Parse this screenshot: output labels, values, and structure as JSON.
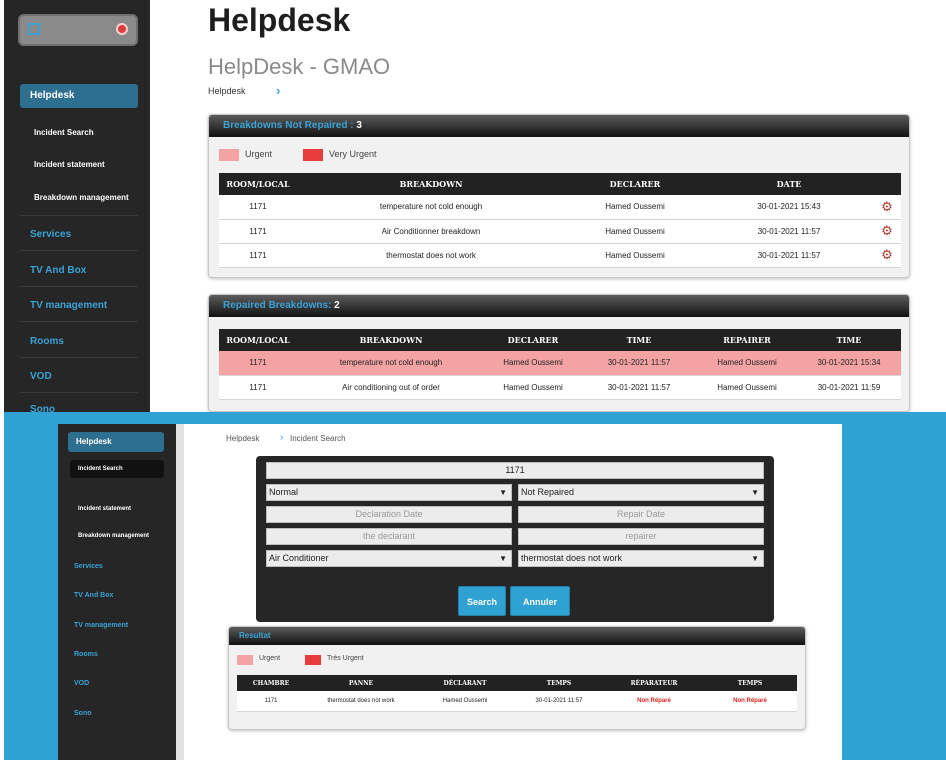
{
  "top": {
    "sidebar": {
      "active": "Helpdesk",
      "subitems": [
        "Incident Search",
        "Incident statement",
        "Breakdown management"
      ],
      "items": [
        "Services",
        "TV And Box",
        "TV management",
        "Rooms",
        "VOD",
        "Sono"
      ]
    },
    "title": "Helpdesk",
    "subtitle": "HelpDesk - GMAO",
    "breadcrumb": "Helpdesk",
    "breakdowns_panel": {
      "title": "Breakdowns Not Repaired :",
      "count": "3",
      "legend": [
        {
          "label": "Urgent",
          "color": "#f3a3a3"
        },
        {
          "label": "Very Urgent",
          "color": "#e83b3b"
        }
      ],
      "headers": [
        "ROOM/LOCAL",
        "BREAKDOWN",
        "DECLARER",
        "DATE"
      ],
      "rows": [
        {
          "room": "1171",
          "breakdown": "temperature not cold enough",
          "declarer": "Hamed Oussemi",
          "date": "30-01-2021 15:43"
        },
        {
          "room": "1171",
          "breakdown": "Air Conditionner breakdown",
          "declarer": "Hamed Oussemi",
          "date": "30-01-2021 11:57"
        },
        {
          "room": "1171",
          "breakdown": "thermostat does not work",
          "declarer": "Hamed Oussemi",
          "date": "30-01-2021 11:57"
        }
      ]
    },
    "repaired_panel": {
      "title": "Repaired Breakdowns:",
      "count": "2",
      "headers": [
        "ROOM/LOCAL",
        "BREAKDOWN",
        "DECLARER",
        "TIME",
        "REPAIRER",
        "TIME"
      ],
      "rows": [
        {
          "room": "1171",
          "breakdown": "temperature not cold enough",
          "declarer": "Hamed Oussemi",
          "time": "30-01-2021 11:57",
          "repairer": "Hamed Oussemi",
          "time2": "30-01-2021 15:34"
        },
        {
          "room": "1171",
          "breakdown": "Air conditioning out of order",
          "declarer": "Hamed Oussemi",
          "time": "30-01-2021 11:57",
          "repairer": "Hamed Oussemi",
          "time2": "30-01-2021 11:59"
        }
      ]
    }
  },
  "bottom": {
    "sidebar": {
      "active": "Helpdesk",
      "subitems": [
        "Incident Search",
        "Incident statement",
        "Breakdown management"
      ],
      "items": [
        "Services",
        "TV And Box",
        "TV management",
        "Rooms",
        "VOD",
        "Sono"
      ]
    },
    "breadcrumb": "Helpdesk",
    "breadcrumb_current": "Incident Search",
    "form": {
      "room_value": "1171",
      "urgency_selected": "Normal",
      "status_selected": "Not Repaired",
      "declaration_date_placeholder": "Declaration Date",
      "repair_date_placeholder": "Repair Date",
      "declarer_placeholder": "the declarant",
      "repairer_placeholder": "repairer",
      "equipment_selected": "Air Conditioner",
      "breakdown_selected": "thermostat does not work",
      "search_label": "Search",
      "cancel_label": "Annuler"
    },
    "result_panel": {
      "title": "Resultat",
      "legend": [
        {
          "label": "Urgent",
          "color": "#f3a3a3"
        },
        {
          "label": "Très Urgent",
          "color": "#e83b3b"
        }
      ],
      "headers": [
        "CHAMBRE",
        "PANNE",
        "DÉCLARANT",
        "TEMPS",
        "RÉPARATEUR",
        "TEMPS"
      ],
      "rows": [
        {
          "room": "1171",
          "breakdown": "thermostat does not work",
          "declarer": "Hamed Oussemi",
          "time": "30-01-2021 11:57",
          "repairer": "Non Réparé",
          "time2": "Non Réparé"
        }
      ],
      "not_repaired_color": "#e0201a"
    }
  },
  "colors": {
    "accent": "#3aa3d6",
    "sidebar_bg": "#262626",
    "frame_bg": "#2fa1d3",
    "urgent": "#f3a3a3",
    "very_urgent": "#e83b3b"
  }
}
